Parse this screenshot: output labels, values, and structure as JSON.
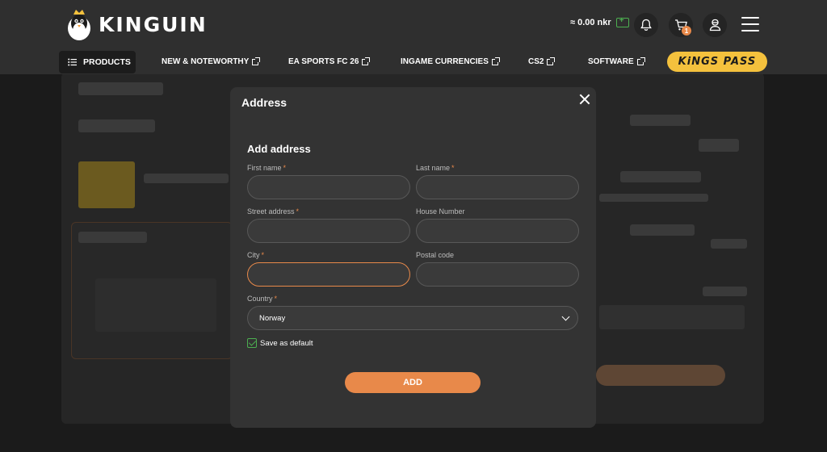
{
  "header": {
    "logo_text": "KINGUIN",
    "balance": "≈ 0.00 nkr",
    "cart_count": "1"
  },
  "nav": {
    "products": "PRODUCTS",
    "items": [
      "NEW & NOTEWORTHY",
      "EA SPORTS FC 26",
      "INGAME CURRENCIES",
      "CS2",
      "SOFTWARE"
    ],
    "kings_pass": "KiNGS PASS"
  },
  "modal": {
    "title": "Address",
    "section_title": "Add address",
    "fields": {
      "first_name": {
        "label": "First name",
        "required": "*",
        "value": ""
      },
      "last_name": {
        "label": "Last name",
        "required": "*",
        "value": ""
      },
      "street": {
        "label": "Street address",
        "required": "*",
        "value": ""
      },
      "house_number": {
        "label": "House Number",
        "value": ""
      },
      "city": {
        "label": "City",
        "required": "*",
        "value": ""
      },
      "postal_code": {
        "label": "Postal code",
        "value": ""
      },
      "country": {
        "label": "Country",
        "required": "*",
        "value": "Norway"
      }
    },
    "save_default_label": "Save as default",
    "add_button": "ADD"
  },
  "colors": {
    "accent": "#e8894a",
    "success": "#4caf50",
    "brand_yellow": "#f4c13d"
  }
}
